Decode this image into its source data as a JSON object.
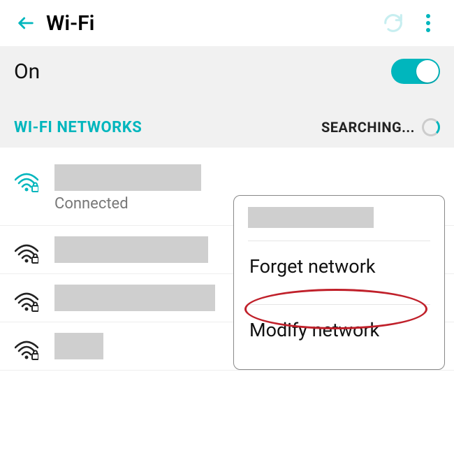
{
  "header": {
    "title": "Wi-Fi"
  },
  "toggle": {
    "state_label": "On",
    "value": true
  },
  "subheader": {
    "left": "WI-FI NETWORKS",
    "right": "SEARCHING..."
  },
  "networks": {
    "list": [
      {
        "status": "Connected",
        "name_redacted_width": 210,
        "secured": true,
        "signal_color": "#00b6bd"
      },
      {
        "status": "",
        "name_redacted_width": 220,
        "secured": true,
        "signal_color": "#222"
      },
      {
        "status": "",
        "name_redacted_width": 230,
        "secured": true,
        "signal_color": "#222"
      },
      {
        "status": "",
        "name_redacted_width": 70,
        "secured": true,
        "signal_color": "#222"
      }
    ]
  },
  "popup": {
    "title_redacted_width": 180,
    "items": {
      "forget": "Forget network",
      "modify": "Modify network"
    }
  },
  "annotation": {
    "highlighted": "modify"
  }
}
